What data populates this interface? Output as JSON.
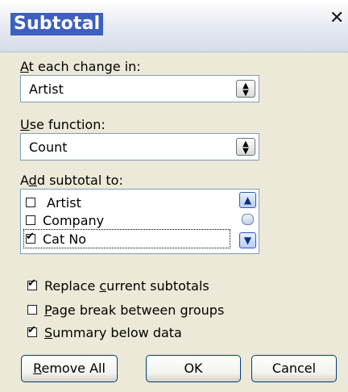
{
  "dialog": {
    "title": "Subtotal",
    "close_glyph": "✕"
  },
  "change": {
    "label_prefix": "",
    "label_hotkey": "A",
    "label_rest": "t each change in:",
    "value": "Artist"
  },
  "function": {
    "label_hotkey": "U",
    "label_rest": "se function:",
    "value": "Count"
  },
  "subtotal_list": {
    "label_prefix": "A",
    "label_hotkey": "d",
    "label_rest": "d subtotal to:",
    "items": [
      {
        "label": "Artist",
        "checked": false
      },
      {
        "label": "Company",
        "checked": false
      },
      {
        "label": "Cat No",
        "checked": true
      }
    ]
  },
  "options": {
    "replace": {
      "pre": "Replace ",
      "hotkey": "c",
      "post": "urrent subtotals",
      "checked": true
    },
    "pagebreak": {
      "pre": "",
      "hotkey": "P",
      "post": "age break between groups",
      "checked": false
    },
    "summary": {
      "pre": "",
      "hotkey": "S",
      "post": "ummary below data",
      "checked": true
    }
  },
  "buttons": {
    "remove_hotkey": "R",
    "remove_rest": "emove All",
    "ok": "OK",
    "cancel": "Cancel"
  },
  "icons": {
    "close": "close-icon",
    "spin": "spin-arrows-icon",
    "scroll_up": "scroll-up-icon",
    "scroll_down": "scroll-down-icon"
  }
}
